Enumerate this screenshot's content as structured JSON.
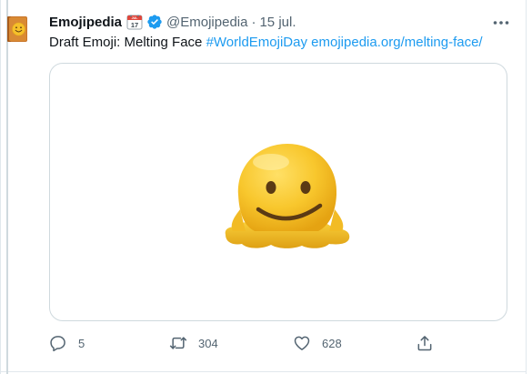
{
  "tweet": {
    "display_name": "Emojipedia",
    "handle": "@Emojipedia",
    "separator": "·",
    "date": "15 jul.",
    "text_prefix": "Draft Emoji: Melting Face ",
    "hashtag": "#WorldEmojiDay",
    "link": "emojipedia.org/melting-face/",
    "calendar_emoji": {
      "month": "JUL",
      "day": "17"
    }
  },
  "actions": {
    "reply_count": "5",
    "retweet_count": "304",
    "like_count": "628"
  },
  "icons": {
    "avatar": "emojipedia-book-logo-icon",
    "calendar": "calendar-icon",
    "verified": "verified-badge-icon",
    "more": "more-dots-icon",
    "reply": "reply-icon",
    "retweet": "retweet-icon",
    "like": "heart-icon",
    "share": "share-icon"
  },
  "colors": {
    "link": "#1d9bf0",
    "verified": "#1d9bf0",
    "secondary_text": "#536471",
    "border": "#cfd9de",
    "emoji_yellow": "#f6c02a"
  }
}
